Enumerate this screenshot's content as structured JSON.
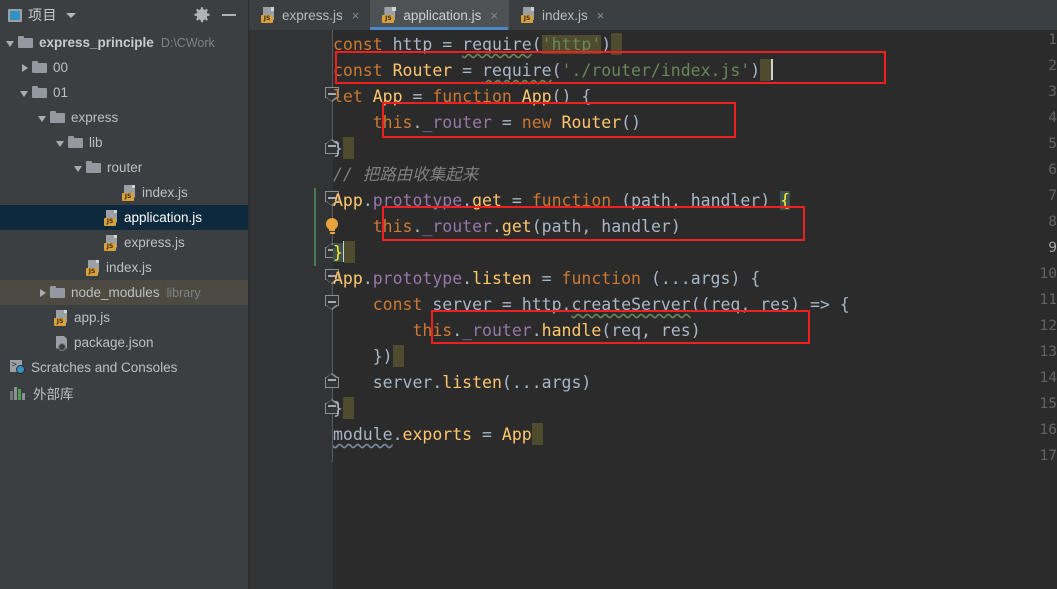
{
  "window": {
    "panel_title": "项目",
    "panel_icon": "project-icon",
    "gear_icon": "gear-icon",
    "minimize_icon": "minimize-icon",
    "dropdown_icon": "chevron-down-icon"
  },
  "tabs": [
    {
      "label": "express.js",
      "icon": "js-file-icon",
      "active": false,
      "close": "×"
    },
    {
      "label": "application.js",
      "icon": "js-file-icon",
      "active": true,
      "close": "×"
    },
    {
      "label": "index.js",
      "icon": "js-file-icon",
      "active": false,
      "close": "×"
    }
  ],
  "tree": [
    {
      "label": "express_principle",
      "sub": "D:\\CWork",
      "icon": "folder-icon",
      "arrow": "down",
      "indent": 0,
      "bold": true,
      "state": "normal"
    },
    {
      "label": "00",
      "sub": "",
      "icon": "folder-icon",
      "arrow": "right",
      "indent": 1,
      "bold": false,
      "state": "normal"
    },
    {
      "label": "01",
      "sub": "",
      "icon": "folder-icon",
      "arrow": "down",
      "indent": 1,
      "bold": false,
      "state": "normal"
    },
    {
      "label": "express",
      "sub": "",
      "icon": "folder-icon",
      "arrow": "down",
      "indent": 2,
      "bold": false,
      "state": "normal"
    },
    {
      "label": "lib",
      "sub": "",
      "icon": "folder-icon",
      "arrow": "down",
      "indent": 3,
      "bold": false,
      "state": "normal"
    },
    {
      "label": "router",
      "sub": "",
      "icon": "folder-icon",
      "arrow": "down",
      "indent": 4,
      "bold": false,
      "state": "normal"
    },
    {
      "label": "index.js",
      "sub": "",
      "icon": "js-file-icon",
      "arrow": "none",
      "indent": 5,
      "bold": false,
      "state": "normal"
    },
    {
      "label": "application.js",
      "sub": "",
      "icon": "js-file-icon",
      "arrow": "none",
      "indent": 4,
      "bold": false,
      "state": "selected"
    },
    {
      "label": "express.js",
      "sub": "",
      "icon": "js-file-icon",
      "arrow": "none",
      "indent": 4,
      "bold": false,
      "state": "normal"
    },
    {
      "label": "index.js",
      "sub": "",
      "icon": "js-file-icon",
      "arrow": "none",
      "indent": 3,
      "bold": false,
      "state": "normal"
    },
    {
      "label": "node_modules",
      "sub": "library",
      "icon": "folder-icon",
      "arrow": "right",
      "indent": 2,
      "bold": false,
      "state": "hover"
    },
    {
      "label": "app.js",
      "sub": "",
      "icon": "js-file-icon",
      "arrow": "none",
      "indent": 2,
      "bold": false,
      "state": "normal"
    },
    {
      "label": "package.json",
      "sub": "",
      "icon": "json-file-icon",
      "arrow": "none",
      "indent": 2,
      "bold": false,
      "state": "normal"
    },
    {
      "label": "Scratches and Consoles",
      "sub": "",
      "icon": "scratches-icon",
      "arrow": "none",
      "indent": 0,
      "bold": false,
      "state": "normal"
    },
    {
      "label": "外部库",
      "sub": "",
      "icon": "external-libraries-icon",
      "arrow": "none",
      "indent": 0,
      "bold": false,
      "state": "normal"
    }
  ],
  "editor": {
    "line_numbers": [
      "1",
      "2",
      "3",
      "4",
      "5",
      "6",
      "7",
      "8",
      "9",
      "10",
      "11",
      "12",
      "13",
      "14",
      "15",
      "16",
      "17"
    ],
    "current_line": 9,
    "lines": [
      "const http = require('http')",
      "const Router = require('./router/index.js')",
      "let App = function App() {",
      "    this._router = new Router()",
      "}",
      "// 把路由收集起来",
      "App.prototype.get = function (path, handler) {",
      "    this._router.get(path, handler)",
      "}",
      "App.prototype.listen = function (...args) {",
      "    const server = http.createServer((req, res) => {",
      "        this._router.handle(req, res)",
      "    })",
      "    server.listen(...args)",
      "}",
      "module.exports = App",
      ""
    ],
    "annotations": {
      "red_boxes": 4,
      "red_box_color": "#f01f20",
      "highlight_color": "#4f4b2e",
      "bulb_line": 8,
      "vcs_marker_lines": "7-9",
      "vcs_marker_color": "#4a7c54"
    }
  },
  "colors": {
    "background": "#2b2b2b",
    "panel": "#3c3f41",
    "gutter": "#313335",
    "selection": "#0d293e",
    "tab_active": "#4e5254",
    "tab_underline": "#4a88c7",
    "keyword": "#cc7832",
    "function": "#ffc66d",
    "string": "#6a8759",
    "property": "#9876aa",
    "text": "#a9b7c6",
    "comment": "#808080",
    "js_badge": "#d9a13b"
  }
}
